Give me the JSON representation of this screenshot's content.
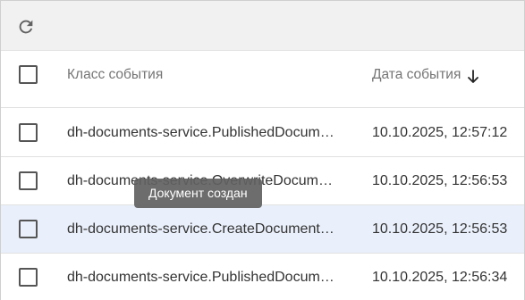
{
  "toolbar": {
    "refresh_icon": "refresh-icon"
  },
  "table": {
    "columns": {
      "event_class": "Класс события",
      "event_date": "Дата события"
    },
    "sort": {
      "column": "event_date",
      "direction": "descending",
      "icon": "arrow-down-icon"
    },
    "rows": [
      {
        "event_class": "dh-documents-service.PublishedDocume…",
        "event_date": "10.10.2025, 12:57:12",
        "selected": false
      },
      {
        "event_class": "dh-documents-service.OverwriteDocumen…",
        "event_date": "10.10.2025, 12:56:53",
        "selected": false
      },
      {
        "event_class": "dh-documents-service.CreateDocumentEv…",
        "event_date": "10.10.2025, 12:56:53",
        "selected": true
      },
      {
        "event_class": "dh-documents-service.PublishedDocume…",
        "event_date": "10.10.2025, 12:56:34",
        "selected": false
      }
    ]
  },
  "tooltip": {
    "text": "Документ создан"
  },
  "colors": {
    "selected_row": "#eaf0fb",
    "toolbar_bg": "#f1f1f1",
    "tooltip_bg": "#616161"
  }
}
